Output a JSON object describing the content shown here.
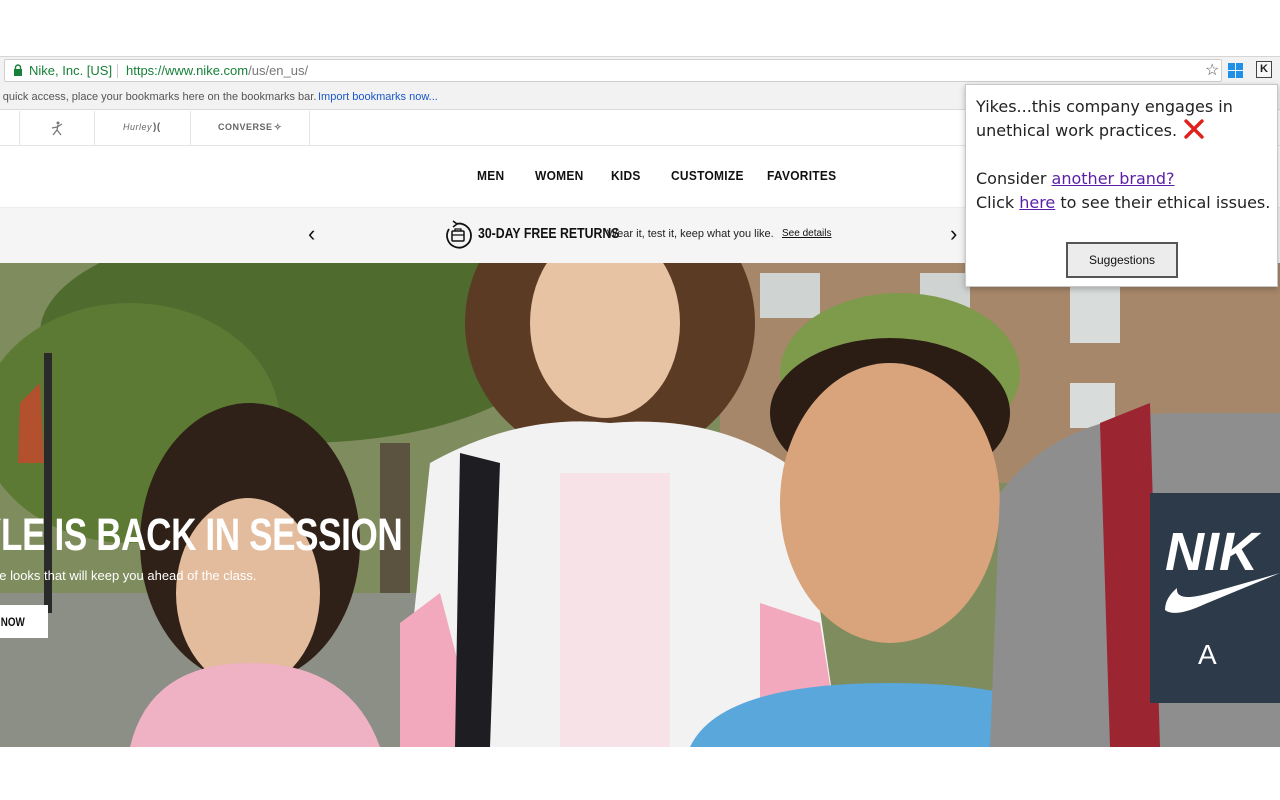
{
  "browser": {
    "site_identity": "Nike, Inc. [US]",
    "url_host": "https://www.nike.com",
    "url_path": "/us/en_us/",
    "bookmarks_message": "r quick access, place your bookmarks here on the bookmarks bar.",
    "import_bookmarks": "Import bookmarks now..."
  },
  "brand_strip": {
    "items": [
      "Hurley",
      "CONVERSE"
    ]
  },
  "nav": {
    "items": [
      "MEN",
      "WOMEN",
      "KIDS",
      "CUSTOMIZE",
      "FAVORITES"
    ]
  },
  "promo": {
    "title": "30-DAY FREE RETURNS",
    "subtitle": "Wear it, test it, keep what you like.",
    "link": "See details"
  },
  "hero": {
    "headline": "YLE IS BACK IN SESSION",
    "subtext": "he looks that will keep you ahead of the class.",
    "cta": "OP NOW",
    "shirt_text_1": "NIK",
    "shirt_text_2": "A I"
  },
  "extension_popup": {
    "line1": "Yikes...this company engages in",
    "line2": "unethical work practices.",
    "consider_prefix": "Consider ",
    "consider_link": "another brand?",
    "click_prefix": "Click ",
    "click_link": "here",
    "click_suffix": " to see their ethical issues.",
    "button": "Suggestions"
  },
  "colors": {
    "secure_green": "#188038",
    "link_blue": "#1a57c9",
    "popup_link_purple": "#5a1fa6",
    "x_red": "#e0201b"
  }
}
